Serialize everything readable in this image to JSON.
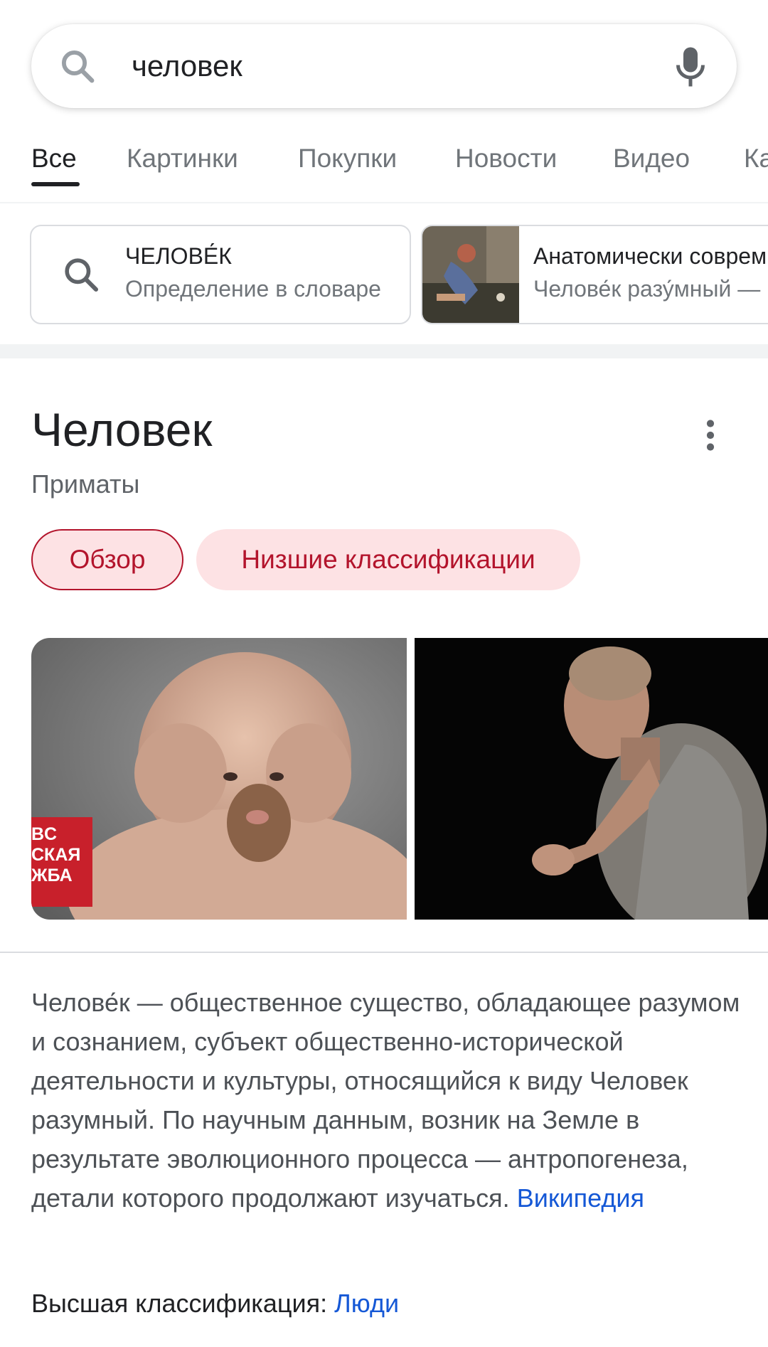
{
  "search": {
    "query": "человек"
  },
  "tabs": [
    {
      "label": "Все",
      "active": true
    },
    {
      "label": "Картинки"
    },
    {
      "label": "Покупки"
    },
    {
      "label": "Новости"
    },
    {
      "label": "Видео"
    },
    {
      "label": "Ка"
    }
  ],
  "chips": [
    {
      "title": "ЧЕЛОВЕ́К",
      "subtitle": "Определение в словаре",
      "icon": "search-icon"
    },
    {
      "title": "Анатомически соврем",
      "subtitle": "Челове́к разу́мный —"
    }
  ],
  "knowledge_panel": {
    "title": "Человек",
    "subtitle": "Приматы",
    "pills": [
      "Обзор",
      "Низшие классификации"
    ],
    "image1_badge": [
      "BC",
      "СКАЯ",
      "ЖБА"
    ],
    "description": "Челове́к — общественное существо, обладающее разумом и сознанием, субъект общественно-исторической деятельности и культуры, относящийся к виду Человек разумный. По научным данным, возник на Земле в результате эволюционного процесса — антропогенеза, детали которого продолжают изучаться.",
    "source_link": "Википедия",
    "higher_label": "Высшая классификация:",
    "higher_value": "Люди"
  },
  "colors": {
    "accent_red": "#b3142c",
    "pill_bg": "#fde2e4",
    "link": "#1558d6"
  }
}
